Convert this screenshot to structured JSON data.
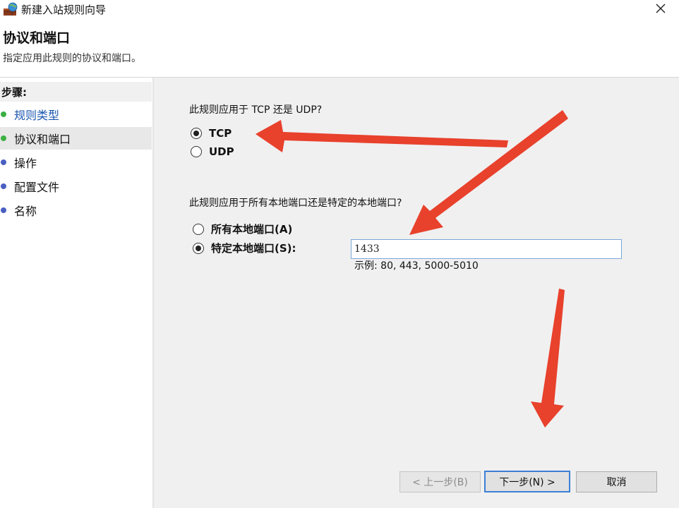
{
  "window": {
    "title": "新建入站规则向导",
    "icons": {
      "app": "firewall-globe-icon",
      "close": "close-icon"
    }
  },
  "header": {
    "title": "协议和端口",
    "subtitle": "指定应用此规则的协议和端口。"
  },
  "sidebar": {
    "steps_title": "步骤:",
    "items": [
      {
        "label": "规则类型",
        "status": "completed",
        "dot_color": "#3cb043",
        "text_color": "#1a56b0"
      },
      {
        "label": "协议和端口",
        "status": "current",
        "dot_color": "#3cb043",
        "text_color": "#111111"
      },
      {
        "label": "操作",
        "status": "pending",
        "dot_color": "#4a5fc1",
        "text_color": "#111111"
      },
      {
        "label": "配置文件",
        "status": "pending",
        "dot_color": "#4a5fc1",
        "text_color": "#111111"
      },
      {
        "label": "名称",
        "status": "pending",
        "dot_color": "#4a5fc1",
        "text_color": "#111111"
      }
    ]
  },
  "main": {
    "protocol_question": "此规则应用于 TCP 还是 UDP?",
    "protocol_options": [
      {
        "label": "TCP",
        "checked": true
      },
      {
        "label": "UDP",
        "checked": false
      }
    ],
    "port_question": "此规则应用于所有本地端口还是特定的本地端口?",
    "port_options": [
      {
        "label": "所有本地端口(A)",
        "checked": false
      },
      {
        "label": "特定本地端口(S):",
        "checked": true
      }
    ],
    "port_value": "1433",
    "port_example": "示例: 80, 443, 5000-5010"
  },
  "buttons": {
    "back": "< 上一步(B)",
    "next": "下一步(N) >",
    "cancel": "取消"
  },
  "annotations": {
    "arrow_color": "#e8412c"
  }
}
